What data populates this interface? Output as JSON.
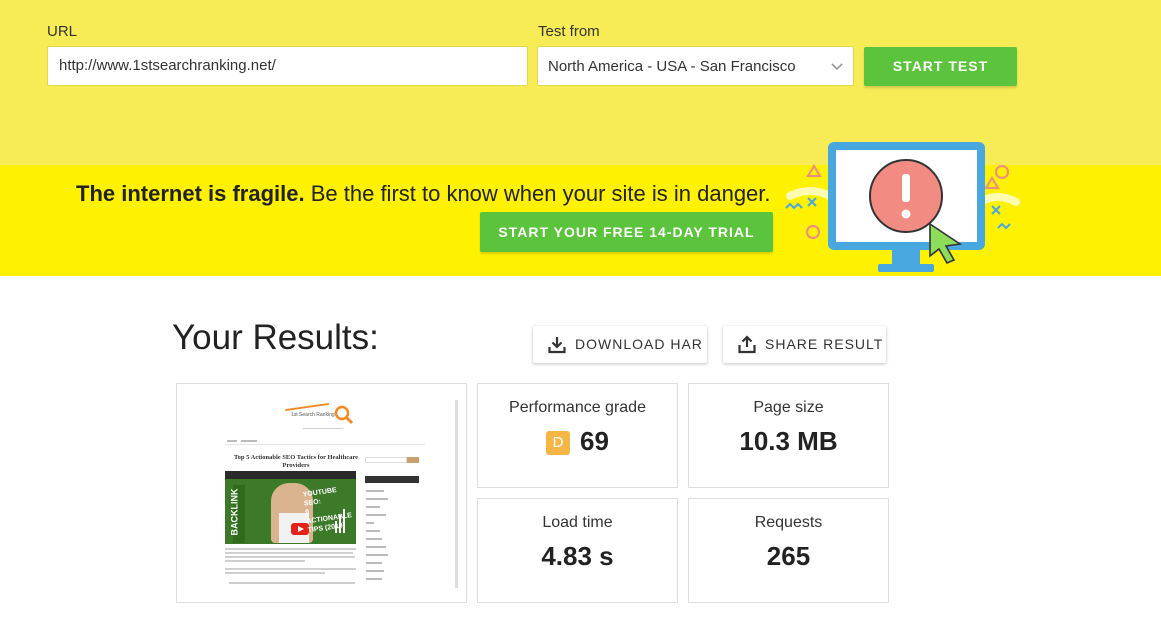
{
  "form": {
    "url_label": "URL",
    "url_value": "http://www.1stsearchranking.net/",
    "test_from_label": "Test from",
    "test_from_value": "North America - USA - San Francisco",
    "start_button": "START TEST"
  },
  "promo": {
    "headline_bold": "The internet is fragile.",
    "headline_rest": " Be the first to know when your site is in danger.",
    "trial_button": "START YOUR FREE 14-DAY TRIAL"
  },
  "results": {
    "title": "Your Results:",
    "download_har": "DOWNLOAD HAR",
    "share_result": "SHARE RESULT",
    "metrics": {
      "performance": {
        "label": "Performance grade",
        "grade": "D",
        "value": "69"
      },
      "page_size": {
        "label": "Page size",
        "value": "10.3 MB"
      },
      "load_time": {
        "label": "Load time",
        "value": "4.83 s"
      },
      "requests": {
        "label": "Requests",
        "value": "265"
      }
    }
  },
  "thumbnail": {
    "logo_text": "1st Search Ranking",
    "article_title": "Top 5 Actionable SEO Tactics for Healthcare Providers",
    "video_text_line1": "YOUTUBE SEO:",
    "video_text_line2": "9 ACTIONABLE",
    "video_text_line3": "TIPS (2019)",
    "side_text": "BACKLINK"
  },
  "colors": {
    "top_bg": "#f7ec55",
    "promo_bg": "#fff200",
    "green": "#5cc43c",
    "grade_badge": "#f4b644"
  },
  "icons": {
    "download": "download-icon",
    "share": "share-icon",
    "chevron": "chevron-down-icon"
  }
}
